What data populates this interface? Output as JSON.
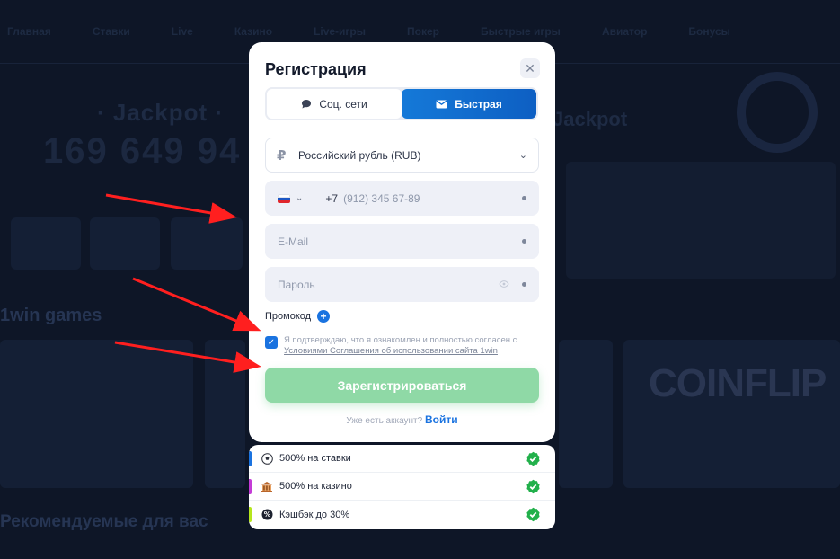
{
  "background": {
    "nav_items": [
      "Главная",
      "Ставки",
      "Live",
      "Казино",
      "Live-игры",
      "Покер",
      "Быстрые игры",
      "Авиатор",
      "Бонусы"
    ],
    "jackpot_left": "· Jackpot ·",
    "jackpot_right": "Jackpot",
    "jackpot_amount": "169 649 94",
    "games_title": "1win games",
    "recommended_title": "Рекомендуемые для вас",
    "coinflip_label": "COINFLIP"
  },
  "modal": {
    "title": "Регистрация",
    "close_icon": "close-icon",
    "tabs": [
      {
        "label": "Соц. сети",
        "icon": "chat-bubble-icon",
        "active": false
      },
      {
        "label": "Быстрая",
        "icon": "envelope-icon",
        "active": true
      }
    ],
    "currency": {
      "symbol": "₽",
      "value": "Российский рубль (RUB)"
    },
    "phone": {
      "country": "RU",
      "code": "+7",
      "placeholder": "(912) 345 67-89"
    },
    "email": {
      "placeholder": "E-Mail"
    },
    "password": {
      "placeholder": "Пароль"
    },
    "promo_label": "Промокод",
    "agree_text": "Я подтверждаю, что я ознакомлен и полностью согласен с",
    "agree_link": "Условиями Соглашения об использовании сайта 1win",
    "agree_checked": true,
    "submit_label": "Зарегистрироваться",
    "have_account": "Уже есть аккаунт?",
    "login_label": "Войти"
  },
  "bonuses": [
    {
      "label": "500% на ставки",
      "icon": "soccer-ball-icon",
      "color": "#1a73e0",
      "checked": true
    },
    {
      "label": "500% на казино",
      "icon": "casino-icon",
      "color": "#c43bd6",
      "checked": true
    },
    {
      "label": "Кэшбэк до 30%",
      "icon": "cashback-icon",
      "color": "#b5e61d",
      "checked": true
    }
  ],
  "colors": {
    "accent_blue": "#1a73e0",
    "submit_green": "#8fd9a6",
    "check_green": "#22b04b",
    "arrow_red": "#ff1f1f",
    "page_bg": "#0e1627"
  }
}
